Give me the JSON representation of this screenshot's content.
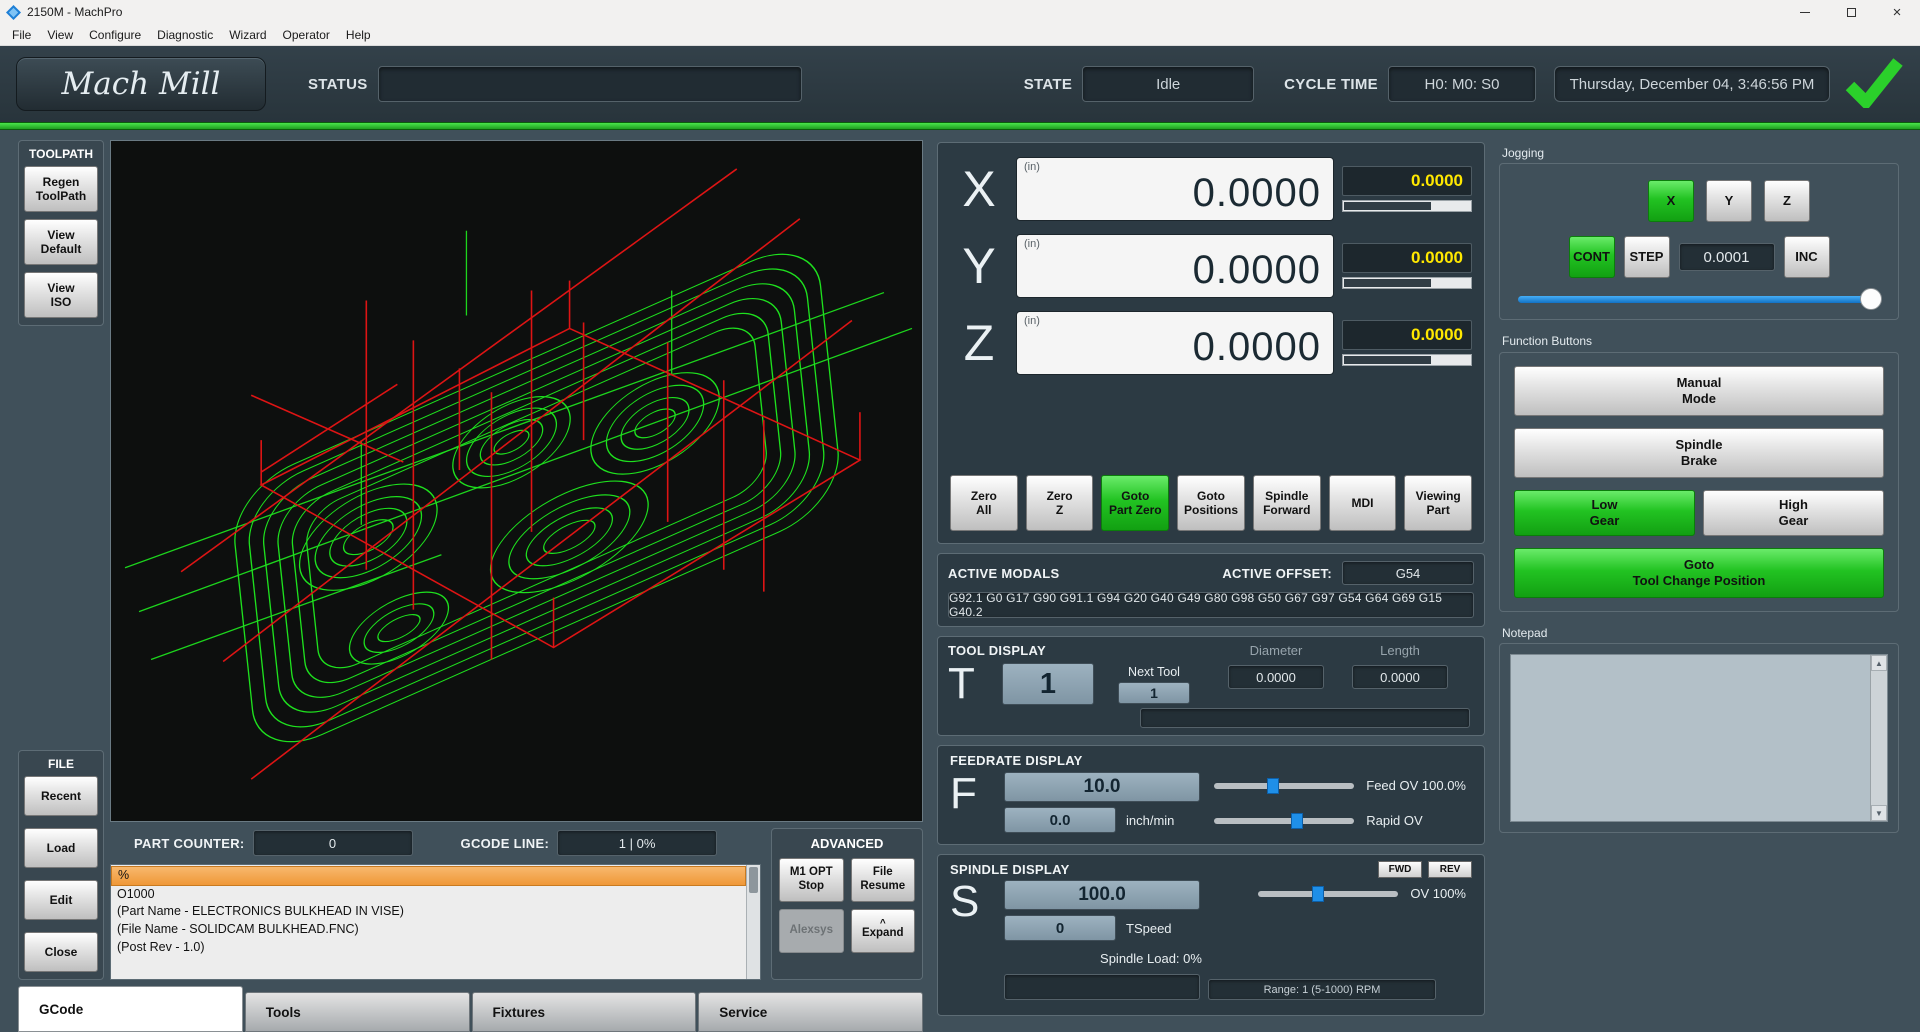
{
  "window": {
    "title": "2150M - MachPro",
    "close_glyph": "×"
  },
  "menu": {
    "items": [
      "File",
      "View",
      "Configure",
      "Diagnostic",
      "Wizard",
      "Operator",
      "Help"
    ]
  },
  "header": {
    "brand": "Mach Mill",
    "status_label": "STATUS",
    "status_value": "",
    "state_label": "STATE",
    "state_value": "Idle",
    "cycle_label": "CYCLE TIME",
    "cycle_value": "H0: M0: S0",
    "datetime": "Thursday, December 04, 3:46:56 PM"
  },
  "toolpath_group": {
    "label": "TOOLPATH",
    "regen": "Regen\nToolPath",
    "view_default": "View\nDefault",
    "view_iso": "View\nISO"
  },
  "file_group": {
    "label": "FILE",
    "recent": "Recent",
    "load": "Load",
    "edit": "Edit",
    "close": "Close"
  },
  "gcode_panel": {
    "part_counter_label": "PART COUNTER:",
    "part_counter_value": "0",
    "gcode_line_label": "GCODE LINE:",
    "gcode_line_value": "1 | 0%",
    "lines": [
      "%",
      "O1000",
      "(Part Name - ELECTRONICS BULKHEAD IN VISE)",
      "(File Name - SOLIDCAM BULKHEAD.FNC)",
      "(Post Rev - 1.0)"
    ]
  },
  "advanced": {
    "label": "ADVANCED",
    "m1_opt_stop": "M1 OPT\nStop",
    "file_resume": "File\nResume",
    "alexsys": "Alexsys",
    "expand_caret": "^",
    "expand": "Expand"
  },
  "tabs": {
    "gcode": "GCode",
    "tools": "Tools",
    "fixtures": "Fixtures",
    "service": "Service"
  },
  "dro": {
    "axes": [
      {
        "letter": "X",
        "unit": "(in)",
        "value": "0.0000",
        "dtg": "0.0000"
      },
      {
        "letter": "Y",
        "unit": "(in)",
        "value": "0.0000",
        "dtg": "0.0000"
      },
      {
        "letter": "Z",
        "unit": "(in)",
        "value": "0.0000",
        "dtg": "0.0000"
      }
    ],
    "buttons": {
      "zero_all": "Zero\nAll",
      "zero_z": "Zero\nZ",
      "goto_part_zero": "Goto\nPart Zero",
      "goto_positions": "Goto\nPositions",
      "spindle_forward": "Spindle\nForward",
      "mdi": "MDI",
      "viewing_part": "Viewing\nPart"
    }
  },
  "active_modals": {
    "title": "ACTIVE MODALS",
    "offset_label": "ACTIVE OFFSET:",
    "offset_value": "G54",
    "modal_string": "G92.1 G0 G17 G90 G91.1 G94 G20 G40 G49 G80 G98 G50 G67 G97 G54 G64 G69 G15 G40.2"
  },
  "tool_display": {
    "title": "TOOL DISPLAY",
    "letter": "T",
    "current_tool": "1",
    "next_tool_label": "Next Tool",
    "next_tool_value": "1",
    "diameter_label": "Diameter",
    "diameter_value": "0.0000",
    "length_label": "Length",
    "length_value": "0.0000"
  },
  "feedrate": {
    "title": "FEEDRATE DISPLAY",
    "letter": "F",
    "set_value": "10.0",
    "actual_value": "0.0",
    "units": "inch/min",
    "feed_ov_label": "Feed OV 100.0%",
    "rapid_ov_label": "Rapid OV"
  },
  "spindle": {
    "title": "SPINDLE DISPLAY",
    "fwd": "FWD",
    "rev": "REV",
    "letter": "S",
    "set_value": "100.0",
    "actual_value": "0",
    "tspeed_label": "TSpeed",
    "ov_label": "OV 100%",
    "load_label": "Spindle Load: 0%",
    "range_label": "Range: 1 (5-1000) RPM"
  },
  "jogging": {
    "label": "Jogging",
    "axis_x": "X",
    "axis_y": "Y",
    "axis_z": "Z",
    "cont": "CONT",
    "step": "STEP",
    "step_value": "0.0001",
    "inc": "INC"
  },
  "function_buttons": {
    "label": "Function Buttons",
    "manual_mode": "Manual\nMode",
    "spindle_brake": "Spindle\nBrake",
    "low_gear": "Low\nGear",
    "high_gear": "High\nGear",
    "goto_tool_change": "Goto\nTool Change Position"
  },
  "notepad": {
    "label": "Notepad"
  },
  "colors": {
    "accent_green": "#2fd02f",
    "dro_value_yellow": "#ffe800",
    "slider_blue": "#1f8fe8",
    "toolpath_green": "#1ee01e",
    "rapid_red": "#dd1414",
    "highlight_orange": "#f2a24d"
  }
}
